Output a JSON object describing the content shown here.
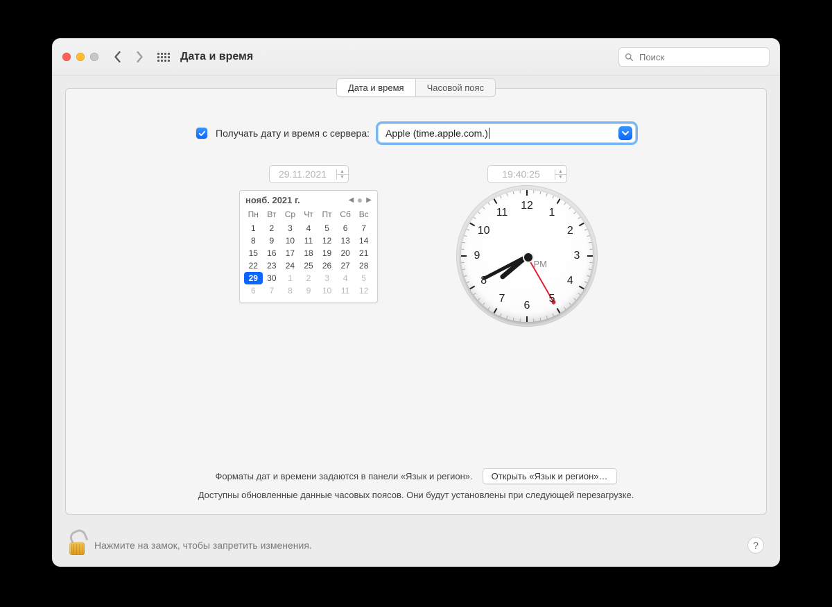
{
  "window": {
    "title": "Дата и время"
  },
  "search": {
    "placeholder": "Поиск"
  },
  "tabs": {
    "datetime": "Дата и время",
    "timezone": "Часовой пояс",
    "active": "datetime"
  },
  "auto": {
    "checked": true,
    "label": "Получать дату и время с сервера:",
    "server": "Apple (time.apple.com.)"
  },
  "date_field": "29.11.2021",
  "time_field": "19:40:25",
  "clock": {
    "hours": 19,
    "minutes": 40,
    "seconds": 25,
    "ampm": "PM"
  },
  "calendar": {
    "title": "нояб. 2021 г.",
    "dow": [
      "Пн",
      "Вт",
      "Ср",
      "Чт",
      "Пт",
      "Сб",
      "Вс"
    ],
    "weeks": [
      [
        {
          "n": 1
        },
        {
          "n": 2
        },
        {
          "n": 3
        },
        {
          "n": 4
        },
        {
          "n": 5
        },
        {
          "n": 6
        },
        {
          "n": 7
        }
      ],
      [
        {
          "n": 8
        },
        {
          "n": 9
        },
        {
          "n": 10
        },
        {
          "n": 11
        },
        {
          "n": 12
        },
        {
          "n": 13
        },
        {
          "n": 14
        }
      ],
      [
        {
          "n": 15
        },
        {
          "n": 16
        },
        {
          "n": 17
        },
        {
          "n": 18
        },
        {
          "n": 19
        },
        {
          "n": 20
        },
        {
          "n": 21
        }
      ],
      [
        {
          "n": 22
        },
        {
          "n": 23
        },
        {
          "n": 24
        },
        {
          "n": 25
        },
        {
          "n": 26
        },
        {
          "n": 27
        },
        {
          "n": 28
        }
      ],
      [
        {
          "n": 29,
          "sel": true
        },
        {
          "n": 30
        },
        {
          "n": 1,
          "dim": true
        },
        {
          "n": 2,
          "dim": true
        },
        {
          "n": 3,
          "dim": true
        },
        {
          "n": 4,
          "dim": true
        },
        {
          "n": 5,
          "dim": true
        }
      ],
      [
        {
          "n": 6,
          "dim": true
        },
        {
          "n": 7,
          "dim": true
        },
        {
          "n": 8,
          "dim": true
        },
        {
          "n": 9,
          "dim": true
        },
        {
          "n": 10,
          "dim": true
        },
        {
          "n": 11,
          "dim": true
        },
        {
          "n": 12,
          "dim": true
        }
      ]
    ]
  },
  "hint": {
    "text": "Форматы дат и времени задаются в панели «Язык и регион».",
    "button": "Открыть «Язык и регион»…"
  },
  "tz_note": "Доступны обновленные данные часовых поясов. Они будут установлены при следующей перезагрузке.",
  "lock_text": "Нажмите на замок, чтобы запретить изменения.",
  "help": "?"
}
